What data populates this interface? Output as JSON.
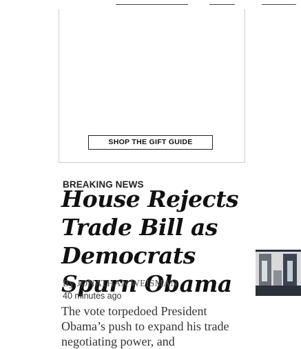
{
  "ad": {
    "button_label": "SHOP THE GIFT GUIDE"
  },
  "story": {
    "kicker": "BREAKING NEWS",
    "headline": "House Rejects Trade Bill as Democrats Spurn Obama",
    "byline": "By JONATHAN WEISMAN",
    "timestamp": "40 minutes ago",
    "summary": "The vote torpedoed President Obama’s push to expand his trade negotiating power, and",
    "photo_icon": "photo-thumbnail-icon"
  }
}
